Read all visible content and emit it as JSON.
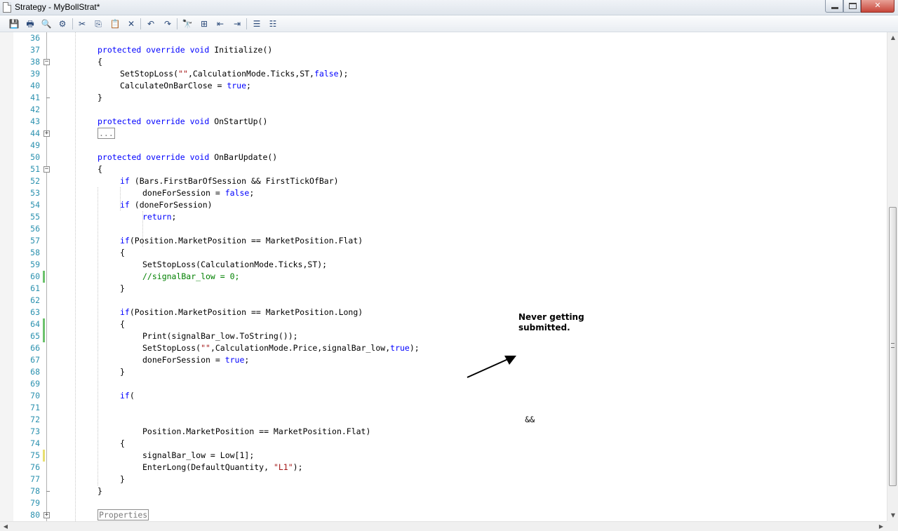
{
  "window": {
    "title": "Strategy - MyBollStrat*",
    "minimize_label": "",
    "maximize_label": "",
    "close_label": "✕"
  },
  "toolbar": {
    "items": [
      {
        "name": "save-icon",
        "glyph": "💾"
      },
      {
        "name": "print-icon",
        "glyph": "🖶"
      },
      {
        "name": "print-preview-icon",
        "glyph": "🔍"
      },
      {
        "name": "page-setup-icon",
        "glyph": "⚙"
      },
      {
        "name": "cut-icon",
        "glyph": "✂"
      },
      {
        "name": "copy-icon",
        "glyph": "⎘"
      },
      {
        "name": "paste-icon",
        "glyph": "📋"
      },
      {
        "name": "delete-icon",
        "glyph": "✕"
      },
      {
        "name": "undo-icon",
        "glyph": "↶"
      },
      {
        "name": "redo-icon",
        "glyph": "↷"
      },
      {
        "name": "find-icon",
        "glyph": "🔭"
      },
      {
        "name": "find-replace-icon",
        "glyph": "⊞"
      },
      {
        "name": "outdent-icon",
        "glyph": "⇤"
      },
      {
        "name": "indent-icon",
        "glyph": "⇥"
      },
      {
        "name": "comment-icon",
        "glyph": "☰"
      },
      {
        "name": "uncomment-icon",
        "glyph": "☷"
      }
    ]
  },
  "annotation": {
    "line1": "Never getting",
    "line2": "submitted."
  },
  "code_lines": [
    {
      "num": "36",
      "indent": 0,
      "tokens": []
    },
    {
      "num": "37",
      "indent": 0,
      "tokens": [
        [
          "kw",
          "protected"
        ],
        [
          "t",
          " "
        ],
        [
          "kw",
          "override"
        ],
        [
          "t",
          " "
        ],
        [
          "kw",
          "void"
        ],
        [
          "t",
          " Initialize()"
        ]
      ]
    },
    {
      "num": "38",
      "indent": 0,
      "fold": "open",
      "tokens": [
        [
          "t",
          "{"
        ]
      ]
    },
    {
      "num": "39",
      "indent": 1,
      "tokens": [
        [
          "t",
          "SetStopLoss("
        ],
        [
          "st",
          "\"\""
        ],
        [
          "t",
          ",CalculationMode.Ticks,ST,"
        ],
        [
          "kw",
          "false"
        ],
        [
          "t",
          ");"
        ]
      ]
    },
    {
      "num": "40",
      "indent": 1,
      "tokens": [
        [
          "t",
          "CalculateOnBarClose = "
        ],
        [
          "kw",
          "true"
        ],
        [
          "t",
          ";"
        ]
      ]
    },
    {
      "num": "41",
      "indent": 0,
      "fold": "end",
      "tokens": [
        [
          "t",
          "}"
        ]
      ]
    },
    {
      "num": "42",
      "indent": 0,
      "tokens": []
    },
    {
      "num": "43",
      "indent": 0,
      "tokens": [
        [
          "kw",
          "protected"
        ],
        [
          "t",
          " "
        ],
        [
          "kw",
          "override"
        ],
        [
          "t",
          " "
        ],
        [
          "kw",
          "void"
        ],
        [
          "t",
          " OnStartUp()"
        ]
      ]
    },
    {
      "num": "44",
      "indent": 0,
      "fold": "closed",
      "tokens": [
        [
          "box",
          "..."
        ]
      ]
    },
    {
      "num": "49",
      "indent": 0,
      "tokens": []
    },
    {
      "num": "50",
      "indent": 0,
      "tokens": [
        [
          "kw",
          "protected"
        ],
        [
          "t",
          " "
        ],
        [
          "kw",
          "override"
        ],
        [
          "t",
          " "
        ],
        [
          "kw",
          "void"
        ],
        [
          "t",
          " OnBarUpdate()"
        ]
      ]
    },
    {
      "num": "51",
      "indent": 0,
      "fold": "open",
      "tokens": [
        [
          "t",
          "{"
        ]
      ]
    },
    {
      "num": "52",
      "indent": 1,
      "tokens": [
        [
          "kw",
          "if"
        ],
        [
          "t",
          " (Bars.FirstBarOfSession && FirstTickOfBar)"
        ]
      ]
    },
    {
      "num": "53",
      "indent": 2,
      "tokens": [
        [
          "t",
          "doneForSession = "
        ],
        [
          "kw",
          "false"
        ],
        [
          "t",
          ";"
        ]
      ]
    },
    {
      "num": "54",
      "indent": 1,
      "tokens": [
        [
          "kw",
          "if"
        ],
        [
          "t",
          " (doneForSession)"
        ]
      ]
    },
    {
      "num": "55",
      "indent": 2,
      "tokens": [
        [
          "kw",
          "return"
        ],
        [
          "t",
          ";"
        ]
      ]
    },
    {
      "num": "56",
      "indent": 0,
      "tokens": []
    },
    {
      "num": "57",
      "indent": 1,
      "tokens": [
        [
          "kw",
          "if"
        ],
        [
          "t",
          "(Position.MarketPosition == MarketPosition.Flat)"
        ]
      ]
    },
    {
      "num": "58",
      "indent": 1,
      "tokens": [
        [
          "t",
          "{"
        ]
      ]
    },
    {
      "num": "59",
      "indent": 2,
      "tokens": [
        [
          "t",
          "SetStopLoss(CalculationMode.Ticks,ST);"
        ]
      ]
    },
    {
      "num": "60",
      "indent": 2,
      "change": "saved",
      "tokens": [
        [
          "cm",
          "//signalBar_low = 0;"
        ]
      ]
    },
    {
      "num": "61",
      "indent": 1,
      "tokens": [
        [
          "t",
          "}"
        ]
      ]
    },
    {
      "num": "62",
      "indent": 0,
      "tokens": []
    },
    {
      "num": "63",
      "indent": 1,
      "tokens": [
        [
          "kw",
          "if"
        ],
        [
          "t",
          "(Position.MarketPosition == MarketPosition.Long)"
        ]
      ]
    },
    {
      "num": "64",
      "indent": 1,
      "change": "saved",
      "tokens": [
        [
          "t",
          "{"
        ]
      ]
    },
    {
      "num": "65",
      "indent": 2,
      "change": "saved",
      "tokens": [
        [
          "t",
          "Print(signalBar_low.ToString());"
        ]
      ]
    },
    {
      "num": "66",
      "indent": 2,
      "tokens": [
        [
          "t",
          "SetStopLoss("
        ],
        [
          "st",
          "\"\""
        ],
        [
          "t",
          ",CalculationMode.Price,signalBar_low,"
        ],
        [
          "kw",
          "true"
        ],
        [
          "t",
          ");"
        ]
      ]
    },
    {
      "num": "67",
      "indent": 2,
      "tokens": [
        [
          "t",
          "doneForSession = "
        ],
        [
          "kw",
          "true"
        ],
        [
          "t",
          ";"
        ]
      ]
    },
    {
      "num": "68",
      "indent": 1,
      "tokens": [
        [
          "t",
          "}"
        ]
      ]
    },
    {
      "num": "69",
      "indent": 0,
      "tokens": []
    },
    {
      "num": "70",
      "indent": 1,
      "tokens": [
        [
          "kw",
          "if"
        ],
        [
          "t",
          "("
        ]
      ]
    },
    {
      "num": "71",
      "indent": 0,
      "tokens": []
    },
    {
      "num": "72",
      "indent": 0,
      "tokens": [
        [
          "t",
          "                                                                                        &&"
        ]
      ]
    },
    {
      "num": "73",
      "indent": 2,
      "tokens": [
        [
          "t",
          "Position.MarketPosition == MarketPosition.Flat)"
        ]
      ]
    },
    {
      "num": "74",
      "indent": 1,
      "tokens": [
        [
          "t",
          "{"
        ]
      ]
    },
    {
      "num": "75",
      "indent": 2,
      "change": "unsaved",
      "tokens": [
        [
          "t",
          "signalBar_low = Low["
        ],
        [
          "t",
          "1"
        ],
        [
          "t",
          "];"
        ]
      ]
    },
    {
      "num": "76",
      "indent": 2,
      "tokens": [
        [
          "t",
          "EnterLong(DefaultQuantity, "
        ],
        [
          "st",
          "\"L1\""
        ],
        [
          "t",
          ");"
        ]
      ]
    },
    {
      "num": "77",
      "indent": 1,
      "tokens": [
        [
          "t",
          "}"
        ]
      ]
    },
    {
      "num": "78",
      "indent": 0,
      "fold": "end",
      "tokens": [
        [
          "t",
          "}"
        ]
      ]
    },
    {
      "num": "79",
      "indent": 0,
      "tokens": []
    },
    {
      "num": "80",
      "indent": 0,
      "fold": "closed",
      "tokens": [
        [
          "box",
          "Properties"
        ]
      ]
    }
  ],
  "colors": {
    "keyword": "#0000ff",
    "comment": "#008000",
    "string": "#a31515",
    "line_number": "#2b91af",
    "change_saved": "#6cc26c",
    "change_unsaved": "#e8e070"
  }
}
